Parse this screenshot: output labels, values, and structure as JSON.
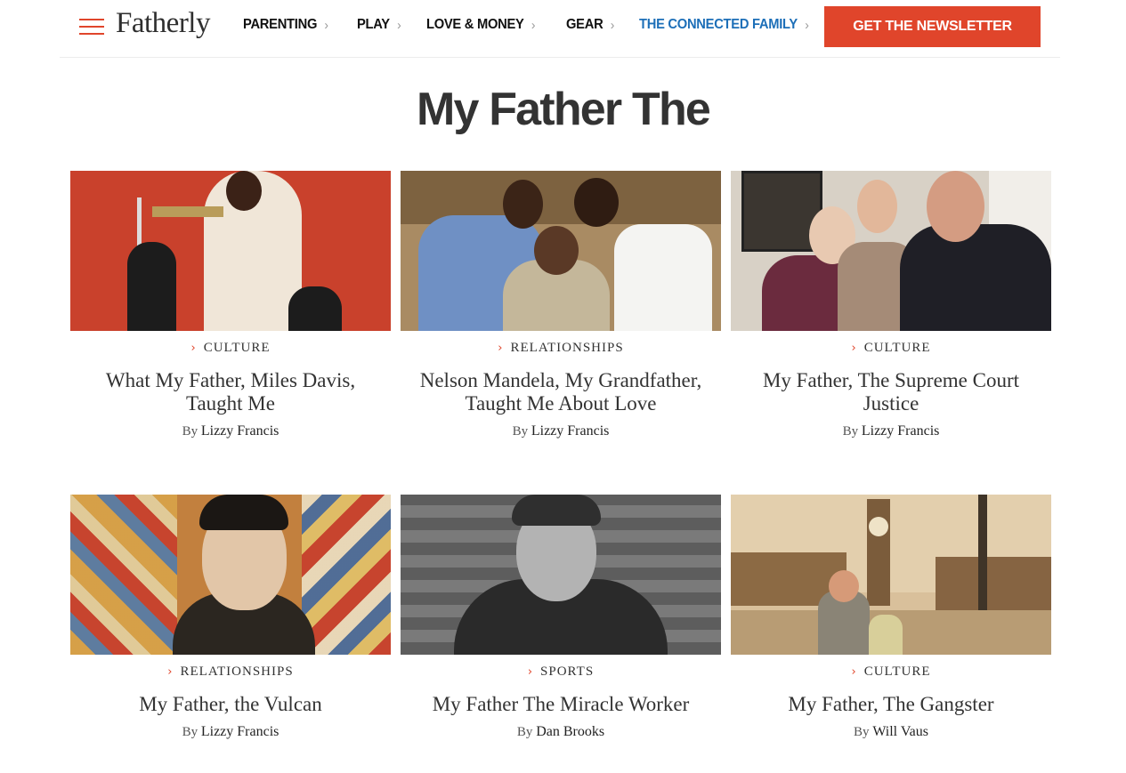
{
  "header": {
    "logo": "Fatherly",
    "nav": [
      {
        "label": "PARENTING"
      },
      {
        "label": "PLAY"
      },
      {
        "label": "LOVE & MONEY"
      },
      {
        "label": "GEAR"
      },
      {
        "label": "THE CONNECTED FAMILY"
      }
    ],
    "newsletter_label": "GET THE NEWSLETTER",
    "accent_color": "#e0452b",
    "link_color": "#1d6fb8"
  },
  "page_title": "My Father The",
  "articles": [
    {
      "category": "CULTURE",
      "title": "What My Father, Miles Davis, Taught Me",
      "by": "By",
      "author": "Lizzy Francis"
    },
    {
      "category": "RELATIONSHIPS",
      "title": "Nelson Mandela, My Grandfather, Taught Me About Love",
      "by": "By",
      "author": "Lizzy Francis"
    },
    {
      "category": "CULTURE",
      "title": "My Father, The Supreme Court Justice",
      "by": "By",
      "author": "Lizzy Francis"
    },
    {
      "category": "RELATIONSHIPS",
      "title": "My Father, the Vulcan",
      "by": "By",
      "author": "Lizzy Francis"
    },
    {
      "category": "SPORTS",
      "title": "My Father The Miracle Worker",
      "by": "By",
      "author": "Dan Brooks"
    },
    {
      "category": "CULTURE",
      "title": "My Father, The Gangster",
      "by": "By",
      "author": "Will Vaus"
    }
  ]
}
